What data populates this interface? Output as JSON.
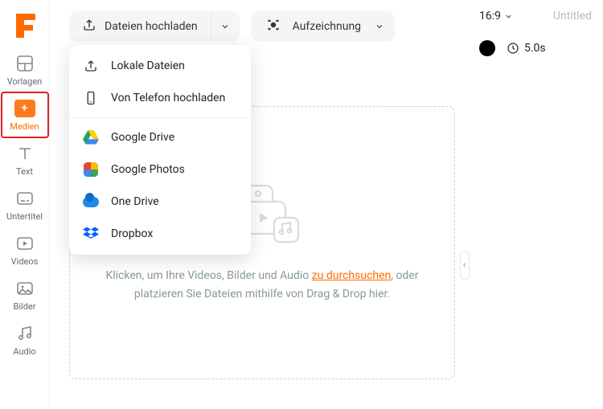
{
  "sidebar": {
    "items": [
      {
        "label": "Vorlagen"
      },
      {
        "label": "Medien"
      },
      {
        "label": "Text"
      },
      {
        "label": "Untertitel"
      },
      {
        "label": "Videos"
      },
      {
        "label": "Bilder"
      },
      {
        "label": "Audio"
      }
    ],
    "active_index": 1
  },
  "toolbar": {
    "upload_label": "Dateien hochladen",
    "record_label": "Aufzeichnung"
  },
  "upload_menu": {
    "local_label": "Lokale Dateien",
    "phone_label": "Von Telefon hochladen",
    "gdrive_label": "Google Drive",
    "gphotos_label": "Google Photos",
    "onedrive_label": "One Drive",
    "dropbox_label": "Dropbox"
  },
  "dropzone": {
    "text_before_link": "Klicken, um Ihre Videos, Bilder und Audio ",
    "link_text": "zu durchsuchen",
    "text_after_link": ", oder platzieren Sie Dateien mithilfe von Drag & Drop hier."
  },
  "right_panel": {
    "aspect_ratio": "16:9",
    "title": "Untitled",
    "duration": "5.0s"
  }
}
